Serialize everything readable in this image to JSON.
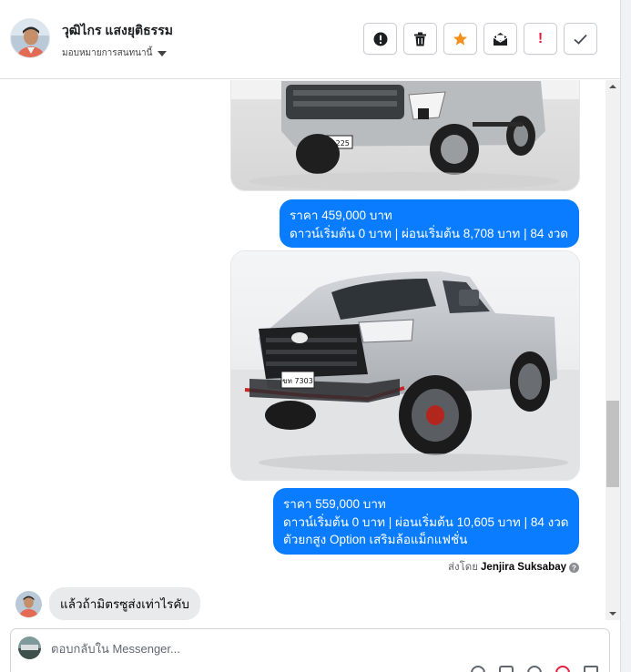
{
  "header": {
    "contact_name": "วุฒิไกร แสงยุติธรรม",
    "assign_label": "มอบหมายการสนทนานี้",
    "actions": [
      {
        "name": "report-icon",
        "label": "!"
      },
      {
        "name": "trash-icon"
      },
      {
        "name": "star-icon"
      },
      {
        "name": "mark-unread-icon"
      },
      {
        "name": "spam-icon",
        "label": "!"
      },
      {
        "name": "done-check-icon"
      }
    ],
    "colors": {
      "star": "#f4901e",
      "spam": "#e41e3f"
    }
  },
  "conversation": {
    "messages": [
      {
        "type": "outgoing",
        "lines": [
          "ราคา 459,000 บาท",
          "ดาวน์เริ่มต้น 0 บาท | ผ่อนเริ่มต้น 8,708 บาท | 84 งวด"
        ]
      },
      {
        "type": "outgoing",
        "lines": [
          "ราคา 559,000 บาท",
          "ดาวน์เริ่มต้น 0 บาท | ผ่อนเริ่มต้น 10,605 บาท | 84 งวด",
          " ตัวยกสูง Option เสริมล้อแม็กแฟชั่น"
        ]
      },
      {
        "type": "incoming",
        "text": "แล้วถ้ามิตรซูส่งเท่าไรคับ"
      }
    ],
    "photos": [
      {
        "alt": "truck-photo-1",
        "plate": "ยร 225"
      },
      {
        "alt": "truck-photo-2",
        "plate": "ขท 7303"
      }
    ],
    "sent_by_prefix": "ส่งโดย",
    "sent_by_name": "Jenjira Suksabay",
    "outgoing_color": "#0a7cff",
    "incoming_color": "#e9eaec"
  },
  "reply": {
    "placeholder": "ตอบกลับใน Messenger..."
  }
}
